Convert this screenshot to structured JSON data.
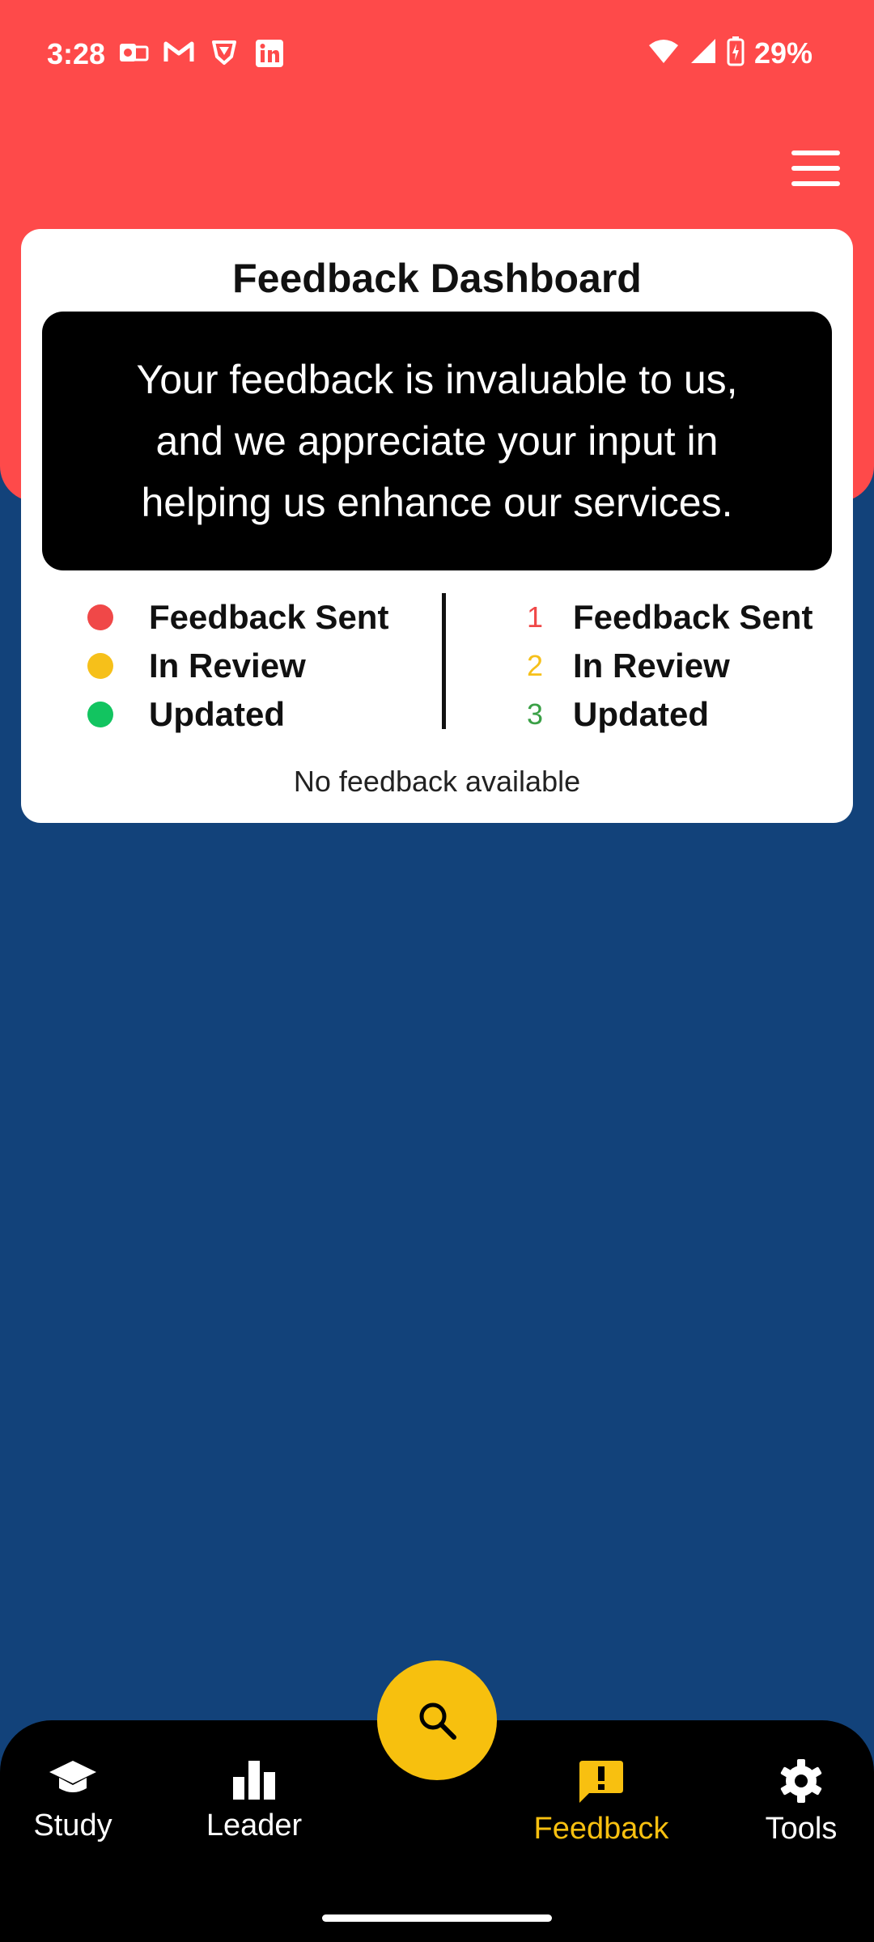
{
  "status_bar": {
    "time": "3:28",
    "notification_icons": [
      "outlook-icon",
      "gmail-icon",
      "vpn-shield-icon",
      "linkedin-icon"
    ],
    "battery_percent": "29%"
  },
  "header": {
    "menu_icon": "hamburger-menu-icon",
    "accent_color": "#fe4a4a"
  },
  "card": {
    "title": "Feedback Dashboard",
    "message": "Your feedback is invaluable to us, and we appreciate your input in helping us enhance our services.",
    "legend_status": [
      {
        "label": "Feedback Sent",
        "color": "#f04848"
      },
      {
        "label": "In Review",
        "color": "#f6c01a"
      },
      {
        "label": "Updated",
        "color": "#12c460"
      }
    ],
    "legend_steps": [
      {
        "number": "1",
        "label": "Feedback Sent",
        "color": "#f04848"
      },
      {
        "number": "2",
        "label": "In Review",
        "color": "#f6c01a"
      },
      {
        "number": "3",
        "label": "Updated",
        "color": "#3aa046"
      }
    ],
    "empty_text": "No feedback available"
  },
  "bottom_nav": {
    "items": [
      {
        "label": "Study",
        "icon": "graduation-cap-icon"
      },
      {
        "label": "Leader",
        "icon": "bar-chart-icon"
      },
      {
        "label": "Feedback",
        "icon": "feedback-icon",
        "active": true
      },
      {
        "label": "Tools",
        "icon": "gear-icon"
      }
    ],
    "fab_icon": "search-icon",
    "active_color": "#f8c010"
  },
  "colors": {
    "background": "#12427a",
    "fab": "#f7c00e"
  }
}
